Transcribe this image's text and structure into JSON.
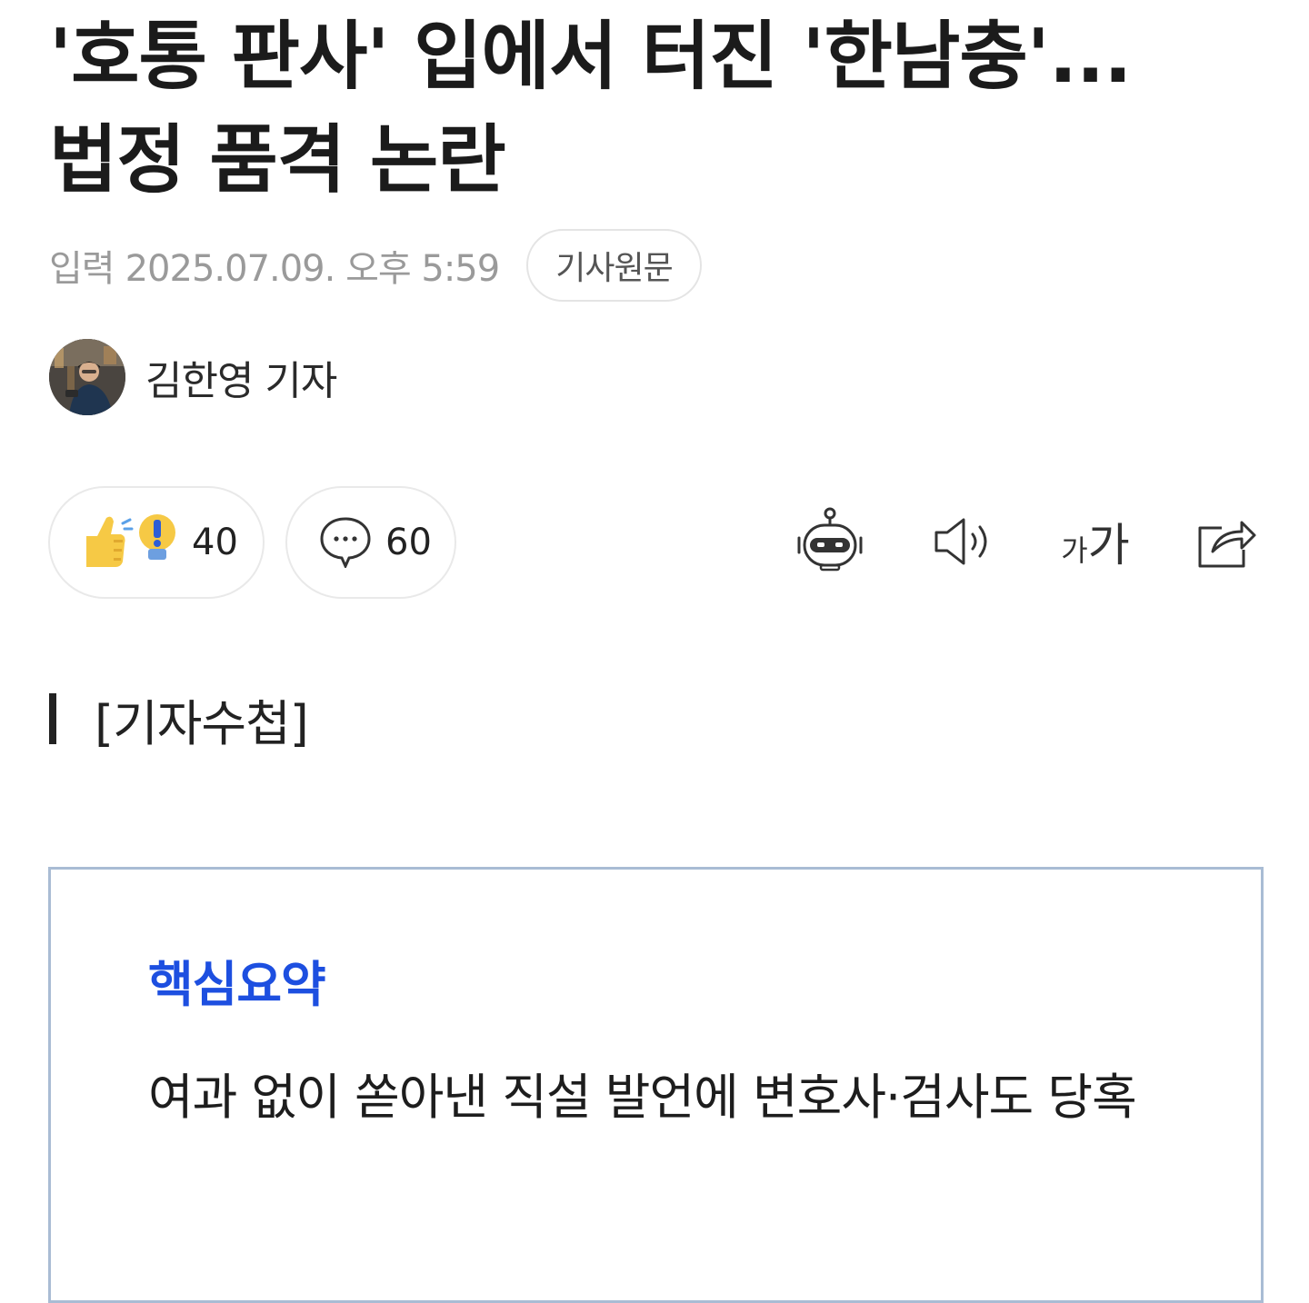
{
  "article": {
    "headline": "'호통 판사' 입에서 터진 '한남충'... 법정 품격 논란",
    "published_label": "입력",
    "published_value": "2025.07.09. 오후 5:59",
    "original_button": "기사원문"
  },
  "author": {
    "name": "김한영 기자",
    "avatar_icon": "reporter-photo"
  },
  "actions": {
    "reaction_icon": "thumbs-up-idea-icon",
    "reaction_count": "40",
    "comment_icon": "speech-bubble-icon",
    "comment_count": "60",
    "tools": [
      {
        "name": "ai-summary-bot-icon"
      },
      {
        "name": "text-to-speech-icon"
      },
      {
        "name": "font-size-icon",
        "small": "가",
        "large": "가"
      },
      {
        "name": "share-icon"
      }
    ]
  },
  "press_note": "[기자수첩]",
  "summary": {
    "title": "핵심요약",
    "body": "여과 없이 쏟아낸 직설 발언에 변호사·검사도 당혹"
  },
  "colors": {
    "summary_title": "#1d4fe0",
    "summary_border": "#a9bcd4",
    "meta_gray": "#9a9a9a"
  }
}
